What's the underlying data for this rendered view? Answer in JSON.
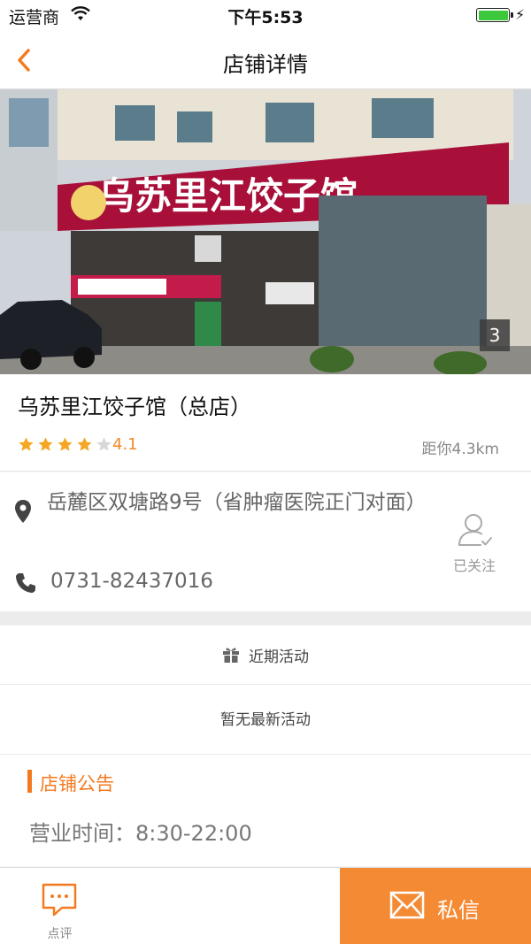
{
  "status_bar": {
    "carrier": "运营商",
    "time": "下午5:53"
  },
  "nav": {
    "title": "店铺详情",
    "back_icon": "chevron-left-icon"
  },
  "hero": {
    "sign_text": "乌苏里江饺子馆",
    "photo_count": "3"
  },
  "store": {
    "name": "乌苏里江饺子馆（总店）",
    "rating": 4.1,
    "rating_text": "4.1",
    "distance": "距你4.3km",
    "address": "岳麓区双塘路9号（省肿瘤医院正门对面）",
    "phone": "0731-82437016",
    "follow_label": "已关注"
  },
  "activity": {
    "title": "近期活动",
    "empty_text": "暂无最新活动"
  },
  "notice": {
    "title": "店铺公告",
    "hours": "营业时间：8:30-22:00"
  },
  "bottom_bar": {
    "review_label": "点评",
    "message_label": "私信"
  },
  "colors": {
    "accent": "#f47a20",
    "button": "#f58a34",
    "star": "#f5a623"
  }
}
